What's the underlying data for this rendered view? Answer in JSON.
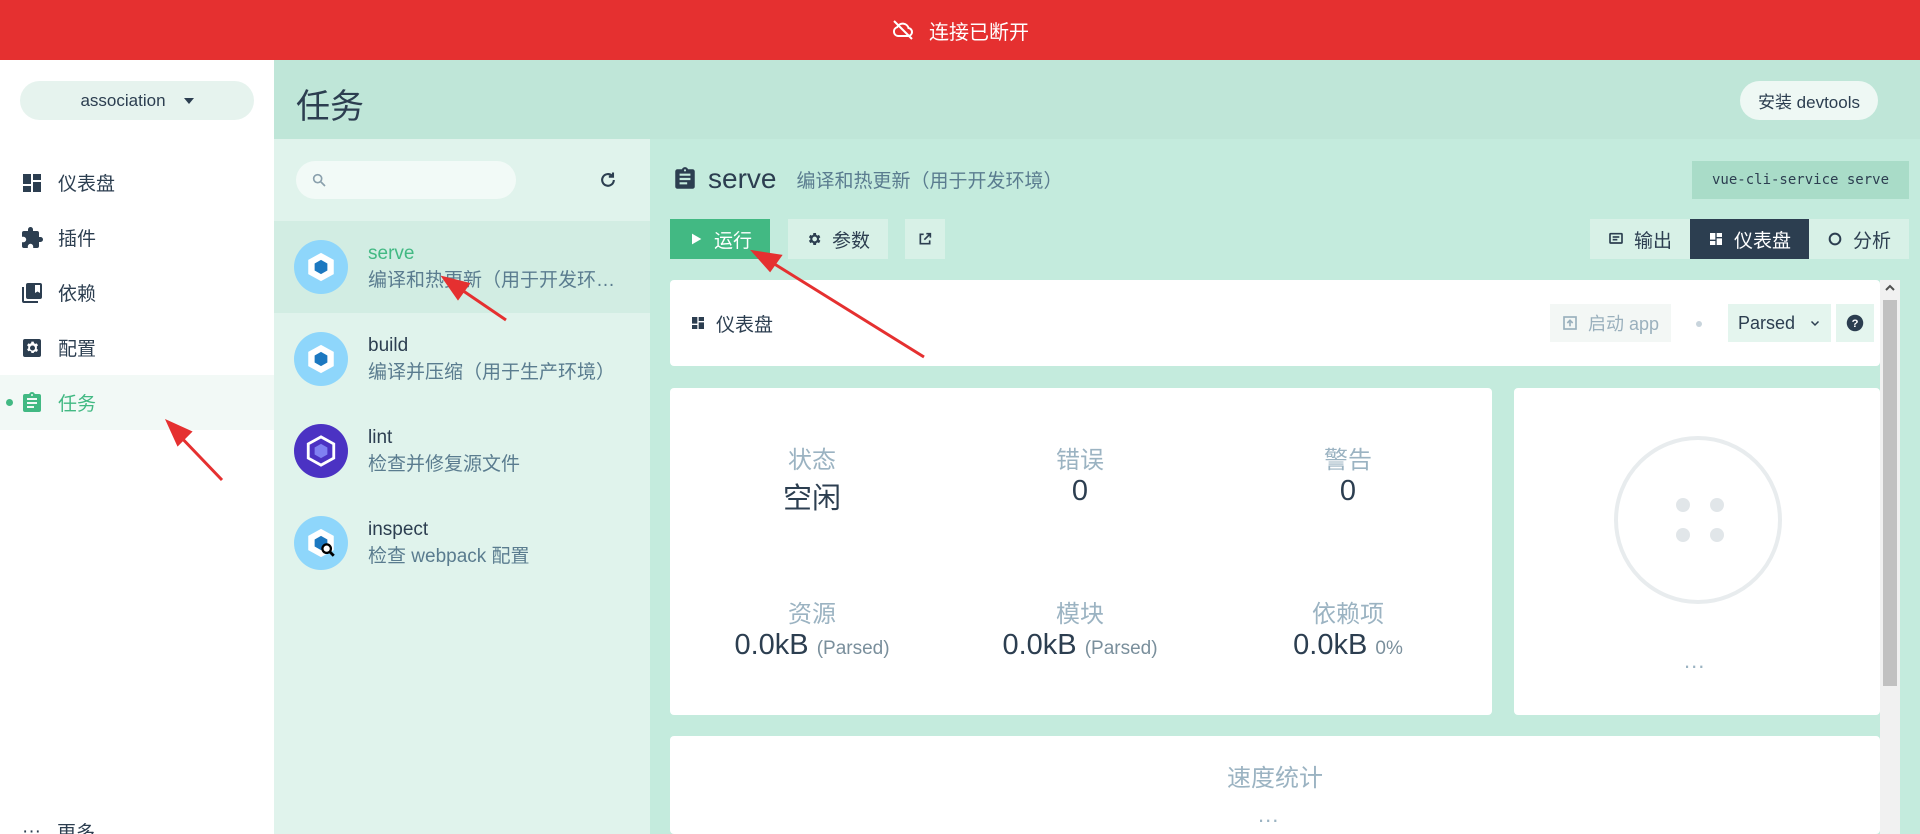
{
  "banner": {
    "text": "连接已断开"
  },
  "sidebar": {
    "project": "association",
    "items": [
      {
        "label": "仪表盘",
        "icon": "dashboard-icon"
      },
      {
        "label": "插件",
        "icon": "puzzle-icon"
      },
      {
        "label": "依赖",
        "icon": "library-icon"
      },
      {
        "label": "配置",
        "icon": "settings-icon"
      },
      {
        "label": "任务",
        "icon": "assignment-icon",
        "active": true
      }
    ],
    "more": "更多"
  },
  "topbar": {
    "title": "任务",
    "devtools": "安装 devtools"
  },
  "tasks": [
    {
      "name": "serve",
      "desc": "编译和热更新（用于开发环境）",
      "selected": true
    },
    {
      "name": "build",
      "desc": "编译并压缩（用于生产环境）"
    },
    {
      "name": "lint",
      "desc": "检查并修复源文件"
    },
    {
      "name": "inspect",
      "desc": "检查 webpack 配置"
    }
  ],
  "detail": {
    "name": "serve",
    "desc": "编译和热更新（用于开发环境）",
    "command": "vue-cli-service serve",
    "run": "运行",
    "params": "参数",
    "tabs": {
      "output": "输出",
      "dashboard": "仪表盘",
      "analyze": "分析"
    },
    "dashboard_label": "仪表盘",
    "launch_app": "启动 app",
    "parsed": "Parsed",
    "stats": {
      "status": {
        "k": "状态",
        "v": "空闲"
      },
      "errors": {
        "k": "错误",
        "v": "0"
      },
      "warnings": {
        "k": "警告",
        "v": "0"
      },
      "assets": {
        "k": "资源",
        "v": "0.0kB",
        "sub": "(Parsed)"
      },
      "modules": {
        "k": "模块",
        "v": "0.0kB",
        "sub": "(Parsed)"
      },
      "deps": {
        "k": "依赖项",
        "v": "0.0kB",
        "sub": "0%"
      }
    },
    "ellipsis": "...",
    "speed": "速度统计"
  },
  "colors": {
    "accent": "#42b983",
    "banner": "#e53030",
    "dark": "#2c3e50"
  }
}
